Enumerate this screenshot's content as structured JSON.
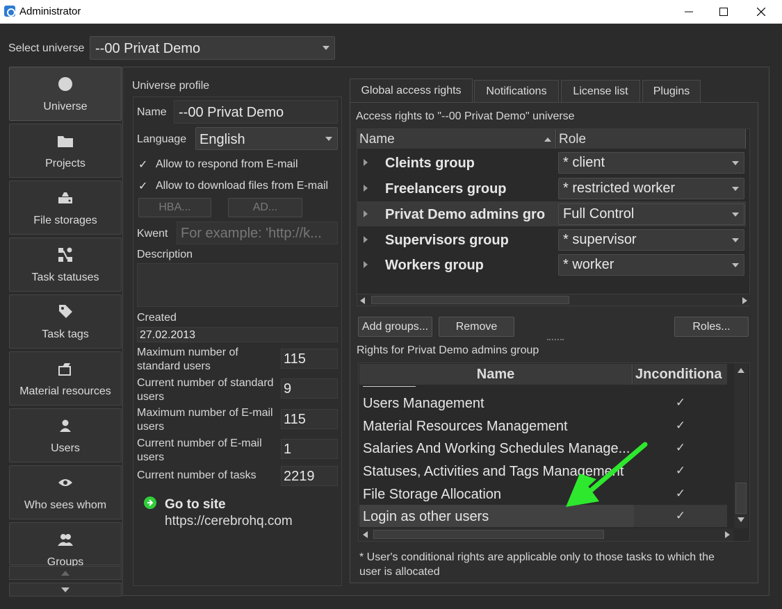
{
  "window": {
    "title": "Administrator"
  },
  "universe_select": {
    "label": "Select universe",
    "value": "--00 Privat Demo"
  },
  "sidebar": {
    "items": [
      {
        "label": "Universe",
        "icon": "circle-icon"
      },
      {
        "label": "Projects",
        "icon": "folder-icon"
      },
      {
        "label": "File storages",
        "icon": "storage-icon"
      },
      {
        "label": "Task statuses",
        "icon": "statuses-icon"
      },
      {
        "label": "Task tags",
        "icon": "tag-icon"
      },
      {
        "label": "Material resources",
        "icon": "resources-icon"
      },
      {
        "label": "Users",
        "icon": "user-icon"
      },
      {
        "label": "Who sees whom",
        "icon": "eye-icon"
      },
      {
        "label": "Groups",
        "icon": "groups-icon"
      }
    ]
  },
  "profile": {
    "title": "Universe profile",
    "name_label": "Name",
    "name_value": "--00 Privat Demo",
    "language_label": "Language",
    "language_value": "English",
    "allow_respond": "Allow to respond from E-mail",
    "allow_download": "Allow to download files from E-mail",
    "hba_button": "HBA...",
    "ad_button": "AD...",
    "kwent_label": "Kwent",
    "kwent_placeholder": "For example: 'http://k...",
    "description_label": "Description",
    "created_label": "Created",
    "created_value": "27.02.2013",
    "stats": [
      {
        "label": "Maximum number of standard users",
        "value": "115"
      },
      {
        "label": "Current number of standard users",
        "value": "9"
      },
      {
        "label": "Maximum number of E-mail users",
        "value": "115"
      },
      {
        "label": "Current number of E-mail users",
        "value": "1"
      },
      {
        "label": "Current number of tasks",
        "value": "2219"
      }
    ],
    "go_to_site_label": "Go to site",
    "site_url": "https://cerebrohq.com"
  },
  "tabs": [
    "Global access rights",
    "Notifications",
    "License list",
    "Plugins"
  ],
  "access": {
    "heading": "Access rights to \"--00 Privat Demo\" universe",
    "col_name": "Name",
    "col_role": "Role",
    "groups": [
      {
        "name": "Cleints group",
        "role": "* client"
      },
      {
        "name": "Freelancers group",
        "role": "* restricted worker"
      },
      {
        "name": "Privat Demo admins group",
        "name_display": "Privat Demo admins gro",
        "role": "Full Control"
      },
      {
        "name": "Supervisors group",
        "role": "* supervisor"
      },
      {
        "name": "Workers group",
        "role": "* worker"
      }
    ],
    "add_groups_button": "Add groups...",
    "remove_button": "Remove",
    "roles_button": "Roles...",
    "rights_for_label": "Rights for  Privat Demo admins group"
  },
  "rights": {
    "col_name": "Name",
    "col_unconditional": "Jnconditiona",
    "rows": [
      {
        "name": "Users Management",
        "check": "✓"
      },
      {
        "name": "Material Resources Management",
        "check": "✓"
      },
      {
        "name": "Salaries And Working Schedules Manage...",
        "check": "✓"
      },
      {
        "name": "Statuses, Activities and Tags Management",
        "check": "✓"
      },
      {
        "name": "File Storage Allocation",
        "check": "✓"
      },
      {
        "name": "Login as other users",
        "check": "✓"
      }
    ],
    "footnote": "* User's conditional rights are applicable only to those tasks to which the user is allocated"
  },
  "colors": {
    "accent_arrow": "#2ee82e",
    "background": "#2b2b2b",
    "panel": "#333333"
  }
}
